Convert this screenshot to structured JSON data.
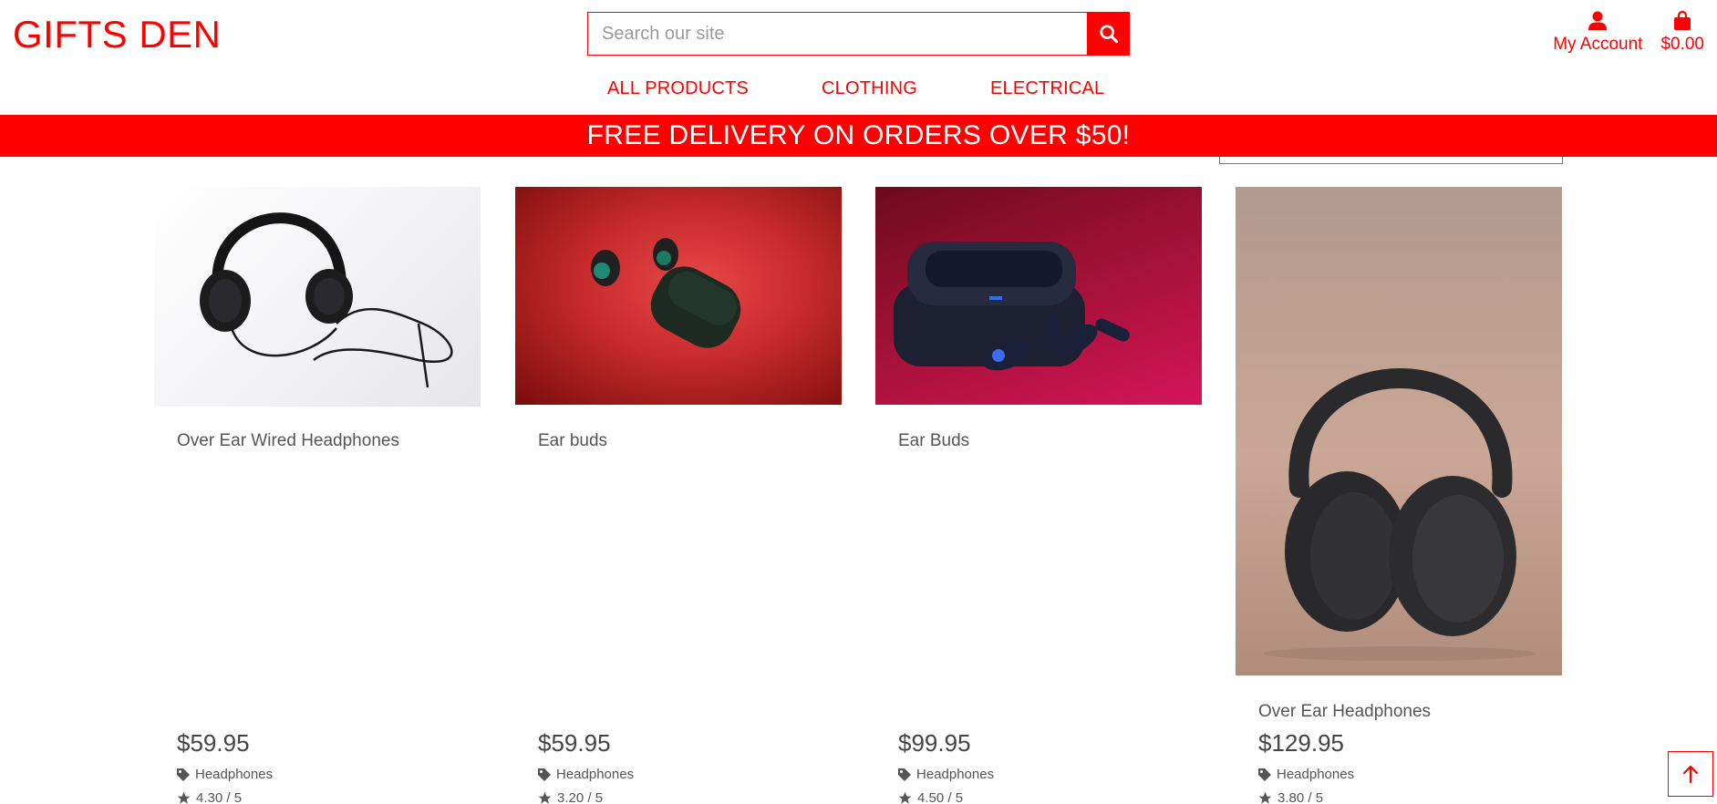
{
  "header": {
    "logo": "GIFTS DEN",
    "search_placeholder": "Search our site",
    "account_label": "My Account",
    "bag_total": "$0.00"
  },
  "menu": [
    "ALL PRODUCTS",
    "CLOTHING",
    "ELECTRICAL"
  ],
  "banner": "FREE DELIVERY ON ORDERS OVER $50!",
  "products": [
    {
      "name": "Over Ear Wired Headphones",
      "price": "$59.95",
      "category": "Headphones",
      "rating": "4.30 / 5"
    },
    {
      "name": "Ear buds",
      "price": "$59.95",
      "category": "Headphones",
      "rating": "3.20 / 5"
    },
    {
      "name": "Ear Buds",
      "price": "$99.95",
      "category": "Headphones",
      "rating": "4.50 / 5"
    },
    {
      "name": "Over Ear Headphones",
      "price": "$129.95",
      "category": "Headphones",
      "rating": "3.80 / 5"
    }
  ],
  "colors": {
    "brand": "#ff0000",
    "accent_teal": "#2a9d8f",
    "text": "#555555"
  },
  "icons": [
    "search-icon",
    "user-icon",
    "shopping-bag-icon",
    "tag-icon",
    "star-icon",
    "arrow-up-icon"
  ]
}
